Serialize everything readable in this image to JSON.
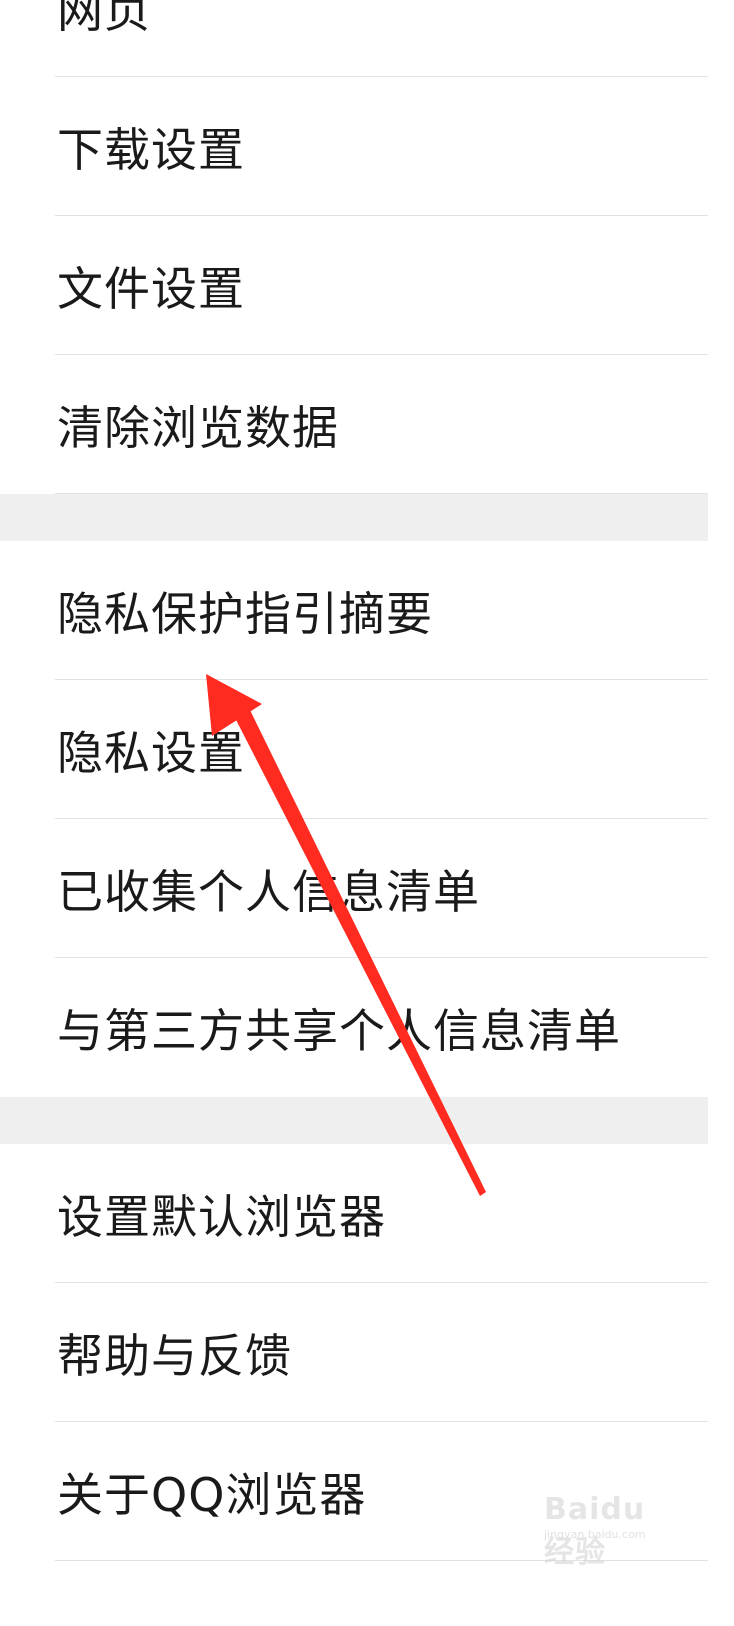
{
  "settings": {
    "group1": [
      {
        "label": "网页"
      },
      {
        "label": "下载设置"
      },
      {
        "label": "文件设置"
      },
      {
        "label": "清除浏览数据"
      }
    ],
    "group2": [
      {
        "label": "隐私保护指引摘要"
      },
      {
        "label": "隐私设置"
      },
      {
        "label": "已收集个人信息清单"
      },
      {
        "label": "与第三方共享个人信息清单"
      }
    ],
    "group3": [
      {
        "label": "设置默认浏览器"
      },
      {
        "label": "帮助与反馈"
      },
      {
        "label": "关于QQ浏览器"
      }
    ]
  },
  "annotation": {
    "arrow_color": "#ff2a20"
  },
  "watermark": {
    "main": "Baidu经验",
    "sub": "jingyan.baidu.com"
  },
  "colors": {
    "background": "#ffffff",
    "section_gap": "#efefef",
    "divider": "#e2e2e2",
    "text": "#1a1a1a"
  }
}
